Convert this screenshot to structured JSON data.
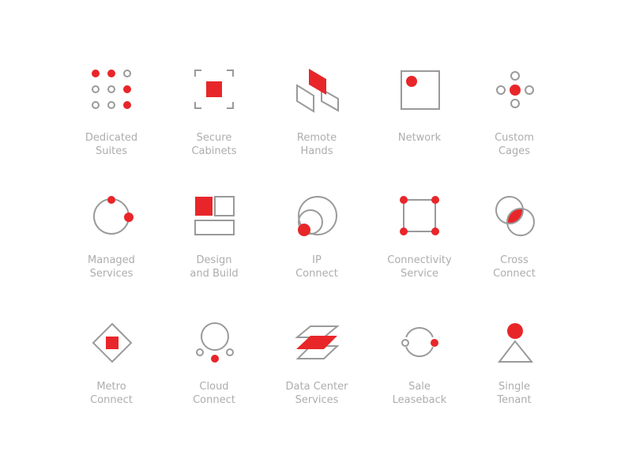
{
  "colors": {
    "accent": "#e8262a",
    "stroke": "#9a9a9a",
    "text": "#adadad"
  },
  "items": [
    {
      "icon": "dots-grid-icon",
      "lines": [
        "Dedicated",
        "Suites"
      ]
    },
    {
      "icon": "bracketed-square-icon",
      "lines": [
        "Secure",
        "Cabinets"
      ]
    },
    {
      "icon": "parallelograms-icon",
      "lines": [
        "Remote",
        "Hands"
      ]
    },
    {
      "icon": "square-dot-icon",
      "lines": [
        "Network"
      ]
    },
    {
      "icon": "cross-dots-icon",
      "lines": [
        "Custom",
        "Cages"
      ]
    },
    {
      "icon": "orbit-circle-icon",
      "lines": [
        "Managed",
        "Services"
      ]
    },
    {
      "icon": "blocks-icon",
      "lines": [
        "Design",
        "and Build"
      ]
    },
    {
      "icon": "nested-circles-icon",
      "lines": [
        "IP",
        "Connect"
      ]
    },
    {
      "icon": "connected-square-icon",
      "lines": [
        "Connectivity",
        "Service"
      ]
    },
    {
      "icon": "overlapping-circles-icon",
      "lines": [
        "Cross",
        "Connect"
      ]
    },
    {
      "icon": "diamond-square-icon",
      "lines": [
        "Metro",
        "Connect"
      ]
    },
    {
      "icon": "cloud-circle-icon",
      "lines": [
        "Cloud",
        "Connect"
      ]
    },
    {
      "icon": "stacked-layers-icon",
      "lines": [
        "Data Center",
        "Services"
      ]
    },
    {
      "icon": "split-circle-icon",
      "lines": [
        "Sale",
        "Leaseback"
      ]
    },
    {
      "icon": "person-triangle-icon",
      "lines": [
        "Single",
        "Tenant"
      ]
    }
  ]
}
